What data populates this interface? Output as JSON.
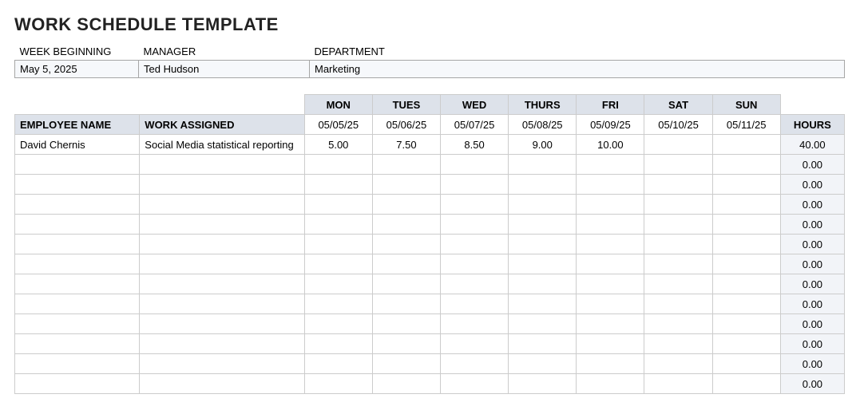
{
  "title": "WORK SCHEDULE TEMPLATE",
  "header": {
    "labels": {
      "week_beginning": "WEEK BEGINNING",
      "manager": "MANAGER",
      "department": "DEPARTMENT"
    },
    "values": {
      "week_beginning": "May 5, 2025",
      "manager": "Ted Hudson",
      "department": "Marketing"
    }
  },
  "schedule": {
    "day_headers": [
      "MON",
      "TUES",
      "WED",
      "THURS",
      "FRI",
      "SAT",
      "SUN"
    ],
    "date_headers": [
      "05/05/25",
      "05/06/25",
      "05/07/25",
      "05/08/25",
      "05/09/25",
      "05/10/25",
      "05/11/25"
    ],
    "col_labels": {
      "employee": "EMPLOYEE NAME",
      "work": "WORK ASSIGNED",
      "hours": "HOURS"
    },
    "rows": [
      {
        "employee": "David Chernis",
        "work": "Social Media statistical reporting",
        "days": [
          "5.00",
          "7.50",
          "8.50",
          "9.00",
          "10.00",
          "",
          ""
        ],
        "hours": "40.00"
      },
      {
        "employee": "",
        "work": "",
        "days": [
          "",
          "",
          "",
          "",
          "",
          "",
          ""
        ],
        "hours": "0.00"
      },
      {
        "employee": "",
        "work": "",
        "days": [
          "",
          "",
          "",
          "",
          "",
          "",
          ""
        ],
        "hours": "0.00"
      },
      {
        "employee": "",
        "work": "",
        "days": [
          "",
          "",
          "",
          "",
          "",
          "",
          ""
        ],
        "hours": "0.00"
      },
      {
        "employee": "",
        "work": "",
        "days": [
          "",
          "",
          "",
          "",
          "",
          "",
          ""
        ],
        "hours": "0.00"
      },
      {
        "employee": "",
        "work": "",
        "days": [
          "",
          "",
          "",
          "",
          "",
          "",
          ""
        ],
        "hours": "0.00"
      },
      {
        "employee": "",
        "work": "",
        "days": [
          "",
          "",
          "",
          "",
          "",
          "",
          ""
        ],
        "hours": "0.00"
      },
      {
        "employee": "",
        "work": "",
        "days": [
          "",
          "",
          "",
          "",
          "",
          "",
          ""
        ],
        "hours": "0.00"
      },
      {
        "employee": "",
        "work": "",
        "days": [
          "",
          "",
          "",
          "",
          "",
          "",
          ""
        ],
        "hours": "0.00"
      },
      {
        "employee": "",
        "work": "",
        "days": [
          "",
          "",
          "",
          "",
          "",
          "",
          ""
        ],
        "hours": "0.00"
      },
      {
        "employee": "",
        "work": "",
        "days": [
          "",
          "",
          "",
          "",
          "",
          "",
          ""
        ],
        "hours": "0.00"
      },
      {
        "employee": "",
        "work": "",
        "days": [
          "",
          "",
          "",
          "",
          "",
          "",
          ""
        ],
        "hours": "0.00"
      },
      {
        "employee": "",
        "work": "",
        "days": [
          "",
          "",
          "",
          "",
          "",
          "",
          ""
        ],
        "hours": "0.00"
      }
    ]
  }
}
